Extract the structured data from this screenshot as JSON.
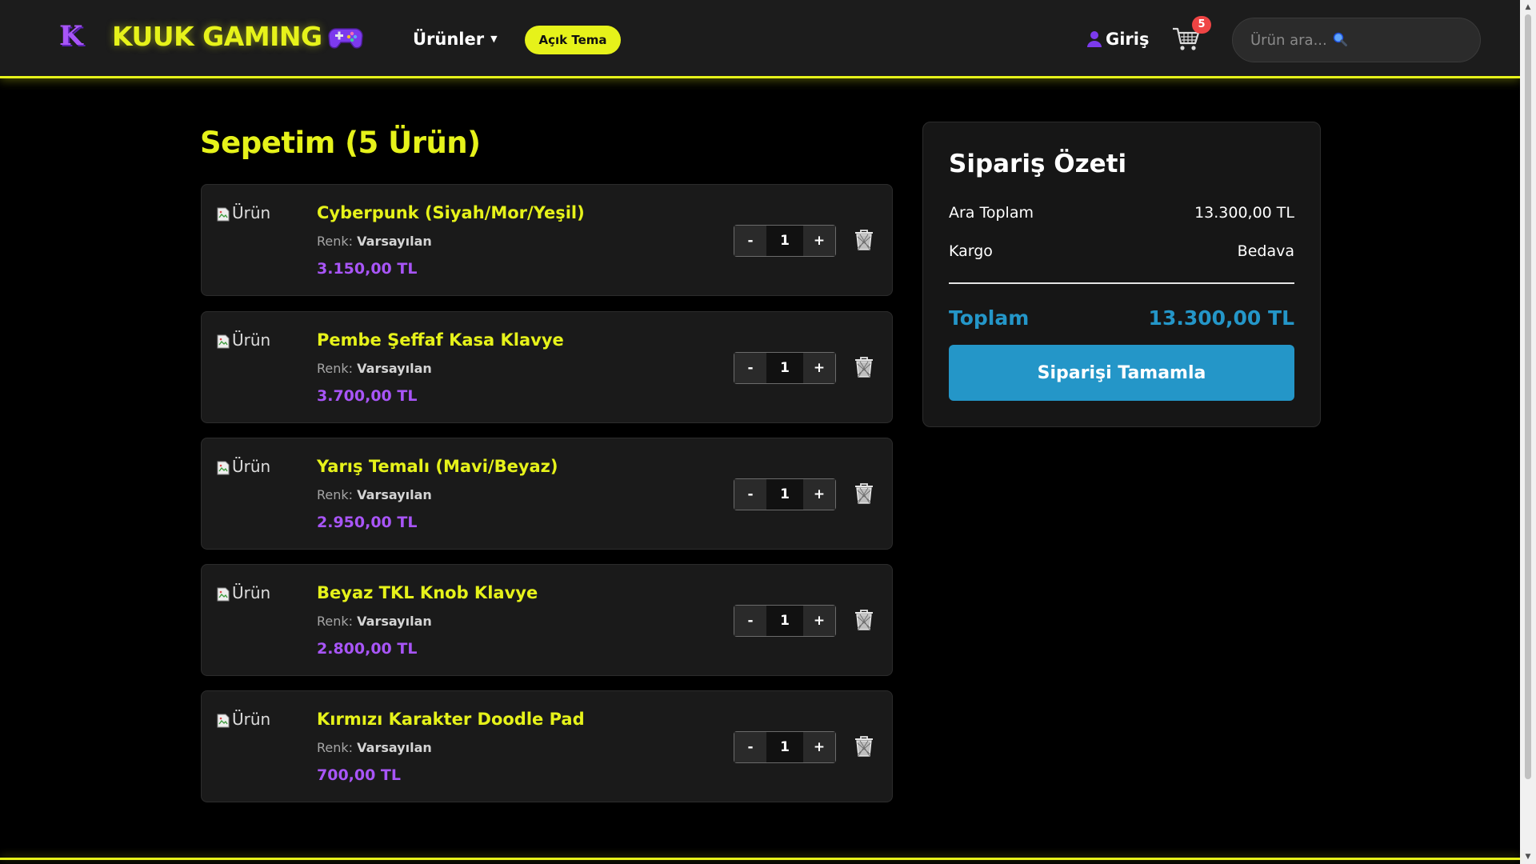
{
  "header": {
    "logo_letter": "K",
    "brand": "KUUK GAMING",
    "nav_products": "Ürünler",
    "theme_button": "Açık Tema",
    "login": "Giriş",
    "cart_count": "5",
    "search_placeholder": "Ürün ara...",
    "icons": [
      "gamepad-icon",
      "user-icon",
      "cart-icon",
      "search-icon"
    ]
  },
  "cart": {
    "title": "Sepetim (5 Ürün)",
    "img_alt": "Ürün",
    "color_label": "Renk:",
    "items": [
      {
        "name": "Cyberpunk (Siyah/Mor/Yeşil)",
        "color": "Varsayılan",
        "price": "3.150,00 TL",
        "qty": "1"
      },
      {
        "name": "Pembe Şeffaf Kasa Klavye",
        "color": "Varsayılan",
        "price": "3.700,00 TL",
        "qty": "1"
      },
      {
        "name": "Yarış Temalı (Mavi/Beyaz)",
        "color": "Varsayılan",
        "price": "2.950,00 TL",
        "qty": "1"
      },
      {
        "name": "Beyaz TKL Knob Klavye",
        "color": "Varsayılan",
        "price": "2.800,00 TL",
        "qty": "1"
      },
      {
        "name": "Kırmızı Karakter Doodle Pad",
        "color": "Varsayılan",
        "price": "700,00 TL",
        "qty": "1"
      }
    ],
    "minus": "-",
    "plus": "+"
  },
  "summary": {
    "title": "Sipariş Özeti",
    "subtotal_label": "Ara Toplam",
    "subtotal_value": "13.300,00 TL",
    "shipping_label": "Kargo",
    "shipping_value": "Bedava",
    "total_label": "Toplam",
    "total_value": "13.300,00 TL",
    "checkout": "Siparişi Tamamla"
  },
  "colors": {
    "accent": "#e6f21a",
    "price": "#a855f7",
    "primary": "#2496c8",
    "badge": "#ef4444"
  }
}
